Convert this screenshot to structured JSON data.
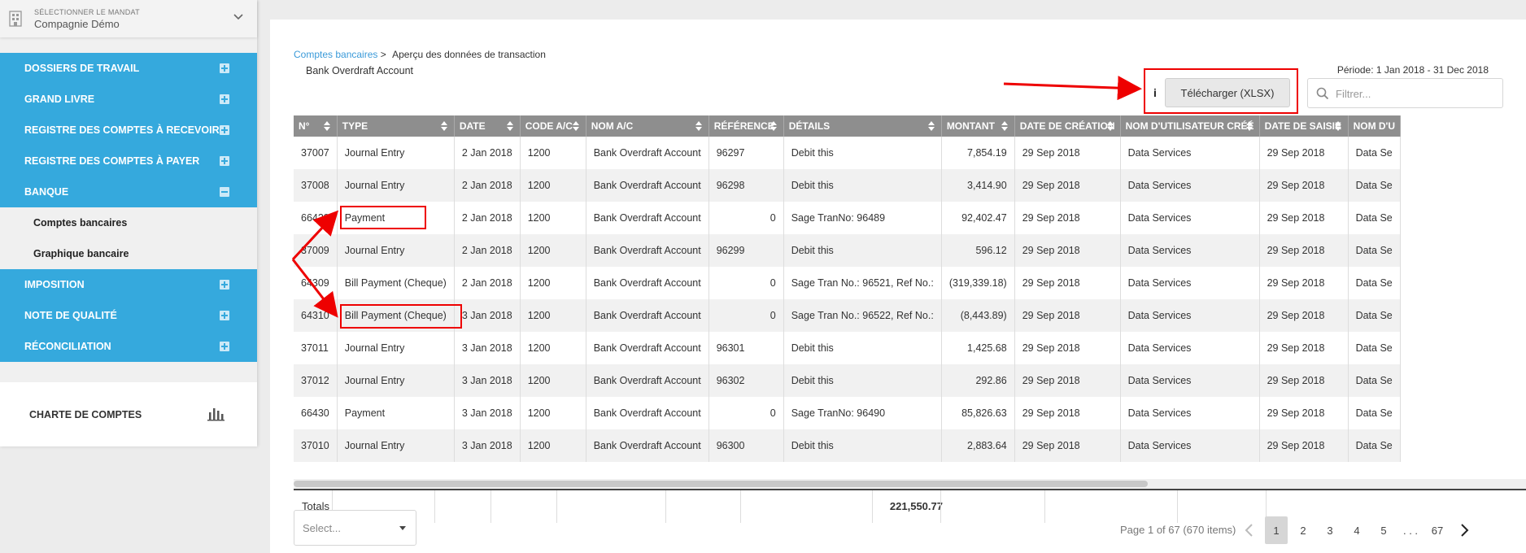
{
  "sidebar": {
    "mandate_label": "SÉLECTIONNER LE MANDAT",
    "mandate_value": "Compagnie Démo",
    "items": [
      {
        "label": "DOSSIERS DE TRAVAIL",
        "expander": "plus"
      },
      {
        "label": "GRAND LIVRE",
        "expander": "plus"
      },
      {
        "label": "REGISTRE DES COMPTES À RECEVOIR",
        "expander": "plus"
      },
      {
        "label": "REGISTRE DES COMPTES À PAYER",
        "expander": "plus"
      },
      {
        "label": "BANQUE",
        "expander": "minus"
      },
      {
        "label": "IMPOSITION",
        "expander": "plus"
      },
      {
        "label": "NOTE DE QUALITÉ",
        "expander": "plus"
      },
      {
        "label": "RÉCONCILIATION",
        "expander": "plus"
      }
    ],
    "sub_items": [
      "Comptes bancaires",
      "Graphique bancaire"
    ],
    "chart_label": "CHARTE DE COMPTES"
  },
  "header": {
    "breadcrumb_link": "Comptes bancaires",
    "breadcrumb_sep": ">",
    "breadcrumb_current": "Aperçu des données de transaction",
    "account_name": "Bank Overdraft Account",
    "period": "Période: 1 Jan 2018 - 31 Dec 2018",
    "info": "i",
    "download_label": "Télécharger (XLSX)",
    "filter_placeholder": "Filtrer..."
  },
  "table": {
    "columns": [
      "N°",
      "TYPE",
      "DATE",
      "CODE A/C",
      "NOM A/C",
      "RÉFÉRENCE",
      "DÉTAILS",
      "MONTANT",
      "DATE DE CRÉATION",
      "NOM D'UTILISATEUR CRÉÉ",
      "DATE DE SAISIE",
      "NOM D'U"
    ],
    "rows": [
      [
        "37007",
        "Journal Entry",
        "2 Jan 2018",
        "1200",
        "Bank Overdraft Account",
        "96297",
        "Debit this",
        "7,854.19",
        "29 Sep 2018",
        "Data Services",
        "29 Sep 2018",
        "Data Se"
      ],
      [
        "37008",
        "Journal Entry",
        "2 Jan 2018",
        "1200",
        "Bank Overdraft Account",
        "96298",
        "Debit this",
        "3,414.90",
        "29 Sep 2018",
        "Data Services",
        "29 Sep 2018",
        "Data Se"
      ],
      [
        "66429",
        "Payment",
        "2 Jan 2018",
        "1200",
        "Bank Overdraft Account",
        "0",
        "Sage TranNo: 96489",
        "92,402.47",
        "29 Sep 2018",
        "Data Services",
        "29 Sep 2018",
        "Data Se"
      ],
      [
        "37009",
        "Journal Entry",
        "2 Jan 2018",
        "1200",
        "Bank Overdraft Account",
        "96299",
        "Debit this",
        "596.12",
        "29 Sep 2018",
        "Data Services",
        "29 Sep 2018",
        "Data Se"
      ],
      [
        "64309",
        "Bill Payment (Cheque)",
        "2 Jan 2018",
        "1200",
        "Bank Overdraft Account",
        "0",
        "Sage Tran No.: 96521, Ref No.:",
        "(319,339.18)",
        "29 Sep 2018",
        "Data Services",
        "29 Sep 2018",
        "Data Se"
      ],
      [
        "64310",
        "Bill Payment (Cheque)",
        "3 Jan 2018",
        "1200",
        "Bank Overdraft Account",
        "0",
        "Sage Tran No.: 96522, Ref No.:",
        "(8,443.89)",
        "29 Sep 2018",
        "Data Services",
        "29 Sep 2018",
        "Data Se"
      ],
      [
        "37011",
        "Journal Entry",
        "3 Jan 2018",
        "1200",
        "Bank Overdraft Account",
        "96301",
        "Debit this",
        "1,425.68",
        "29 Sep 2018",
        "Data Services",
        "29 Sep 2018",
        "Data Se"
      ],
      [
        "37012",
        "Journal Entry",
        "3 Jan 2018",
        "1200",
        "Bank Overdraft Account",
        "96302",
        "Debit this",
        "292.86",
        "29 Sep 2018",
        "Data Services",
        "29 Sep 2018",
        "Data Se"
      ],
      [
        "66430",
        "Payment",
        "3 Jan 2018",
        "1200",
        "Bank Overdraft Account",
        "0",
        "Sage TranNo: 96490",
        "85,826.63",
        "29 Sep 2018",
        "Data Services",
        "29 Sep 2018",
        "Data Se"
      ],
      [
        "37010",
        "Journal Entry",
        "3 Jan 2018",
        "1200",
        "Bank Overdraft Account",
        "96300",
        "Debit this",
        "2,883.64",
        "29 Sep 2018",
        "Data Services",
        "29 Sep 2018",
        "Data Se"
      ]
    ],
    "totals_label": "Totals",
    "totals_amount": "221,550.77"
  },
  "footer": {
    "select_placeholder": "Select...",
    "page_info": "Page 1 of 67 (670 items)",
    "pages": [
      "1",
      "2",
      "3",
      "4",
      "5",
      ". . .",
      "67"
    ],
    "active_page": "1"
  },
  "colors": {
    "sidebar_blue": "#35a9dd",
    "header_gray": "#8e8e8e",
    "annotation_red": "#e00000",
    "link_blue": "#3a9ad9"
  }
}
